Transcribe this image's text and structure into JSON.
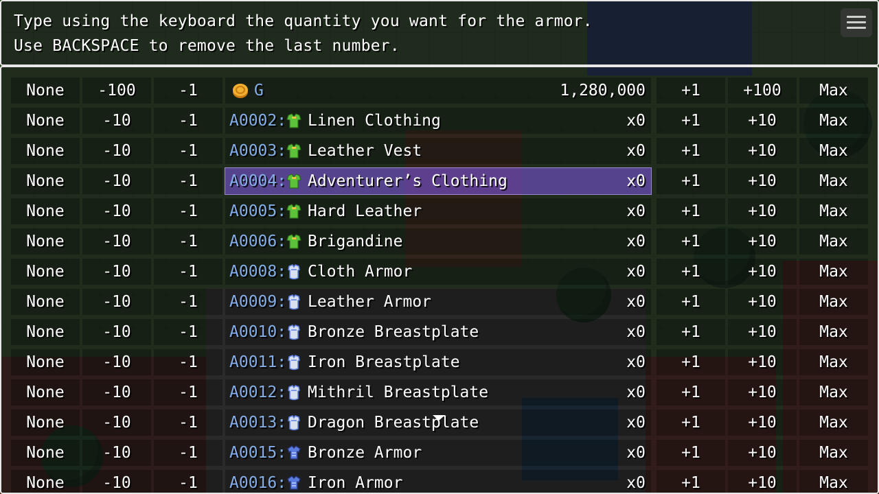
{
  "help": {
    "line1": "Type using the keyboard the quantity you want for the armor.",
    "line2": "Use BACKSPACE to remove the last number."
  },
  "gold_row": {
    "none": "None",
    "minus": "-100",
    "minus_one": "-1",
    "currency": "G",
    "amount": "1,280,000",
    "plus_one": "+1",
    "plus": "+100",
    "max": "Max",
    "icon": "gold-coin-icon"
  },
  "colors": {
    "id_text": "#84aee8",
    "selection": "#7850d2",
    "clothing_icon": "#5cc23a",
    "armor_icon": "#5b7de0"
  },
  "items": [
    {
      "none": "None",
      "minus": "-10",
      "minus_one": "-1",
      "id": "A0002:",
      "icon": "clothing-icon",
      "name": "Linen Clothing",
      "qty": "x0",
      "plus_one": "+1",
      "plus": "+10",
      "max": "Max"
    },
    {
      "none": "None",
      "minus": "-10",
      "minus_one": "-1",
      "id": "A0003:",
      "icon": "clothing-icon",
      "name": "Leather Vest",
      "qty": "x0",
      "plus_one": "+1",
      "plus": "+10",
      "max": "Max"
    },
    {
      "none": "None",
      "minus": "-10",
      "minus_one": "-1",
      "id": "A0004:",
      "icon": "clothing-icon",
      "name": "Adventurer’s Clothing",
      "qty": "x0",
      "plus_one": "+1",
      "plus": "+10",
      "max": "Max",
      "selected": true
    },
    {
      "none": "None",
      "minus": "-10",
      "minus_one": "-1",
      "id": "A0005:",
      "icon": "clothing-icon",
      "name": "Hard Leather",
      "qty": "x0",
      "plus_one": "+1",
      "plus": "+10",
      "max": "Max"
    },
    {
      "none": "None",
      "minus": "-10",
      "minus_one": "-1",
      "id": "A0006:",
      "icon": "clothing-icon",
      "name": "Brigandine",
      "qty": "x0",
      "plus_one": "+1",
      "plus": "+10",
      "max": "Max"
    },
    {
      "none": "None",
      "minus": "-10",
      "minus_one": "-1",
      "id": "A0008:",
      "icon": "body-armor-icon",
      "name": "Cloth Armor",
      "qty": "x0",
      "plus_one": "+1",
      "plus": "+10",
      "max": "Max"
    },
    {
      "none": "None",
      "minus": "-10",
      "minus_one": "-1",
      "id": "A0009:",
      "icon": "body-armor-icon",
      "name": "Leather Armor",
      "qty": "x0",
      "plus_one": "+1",
      "plus": "+10",
      "max": "Max"
    },
    {
      "none": "None",
      "minus": "-10",
      "minus_one": "-1",
      "id": "A0010:",
      "icon": "body-armor-icon",
      "name": "Bronze Breastplate",
      "qty": "x0",
      "plus_one": "+1",
      "plus": "+10",
      "max": "Max"
    },
    {
      "none": "None",
      "minus": "-10",
      "minus_one": "-1",
      "id": "A0011:",
      "icon": "body-armor-icon",
      "name": "Iron Breastplate",
      "qty": "x0",
      "plus_one": "+1",
      "plus": "+10",
      "max": "Max"
    },
    {
      "none": "None",
      "minus": "-10",
      "minus_one": "-1",
      "id": "A0012:",
      "icon": "body-armor-icon",
      "name": "Mithril Breastplate",
      "qty": "x0",
      "plus_one": "+1",
      "plus": "+10",
      "max": "Max"
    },
    {
      "none": "None",
      "minus": "-10",
      "minus_one": "-1",
      "id": "A0013:",
      "icon": "body-armor-icon",
      "name": "Dragon Breastplate",
      "qty": "x0",
      "plus_one": "+1",
      "plus": "+10",
      "max": "Max"
    },
    {
      "none": "None",
      "minus": "-10",
      "minus_one": "-1",
      "id": "A0015:",
      "icon": "plate-armor-icon",
      "name": "Bronze Armor",
      "qty": "x0",
      "plus_one": "+1",
      "plus": "+10",
      "max": "Max"
    },
    {
      "none": "None",
      "minus": "-10",
      "minus_one": "-1",
      "id": "A0016:",
      "icon": "plate-armor-icon",
      "name": "Iron Armor",
      "qty": "x0",
      "plus_one": "+1",
      "plus": "+10",
      "max": "Max"
    }
  ]
}
